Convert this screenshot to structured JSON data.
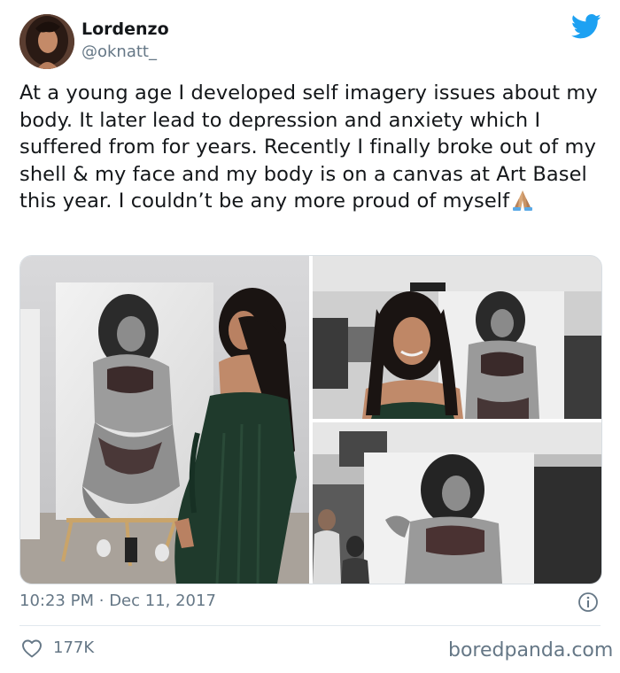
{
  "user": {
    "display_name": "Lordenzo",
    "handle": "@oknatt_"
  },
  "tweet": {
    "text": "At a young age I developed self imagery issues about my body. It later lead to depression and anxiety which I suffered from for years. Recently I finally broke out of my shell & my face and my body is on a canvas at Art Basel this year. I couldn’t be any more proud of myself",
    "emoji": "folded-hands-emoji"
  },
  "media": {
    "photo_count": 3
  },
  "meta": {
    "time": "10:23 PM",
    "separator": "·",
    "date": "Dec 11, 2017"
  },
  "stats": {
    "likes": "177K"
  },
  "watermark": "boredpanda.com",
  "icons": {
    "brand": "twitter-bird-icon",
    "info": "info-icon",
    "like": "heart-icon"
  },
  "colors": {
    "twitter_blue": "#1da1f2",
    "text": "#14171a",
    "secondary_text": "#657786",
    "divider": "#e1e8ed"
  }
}
